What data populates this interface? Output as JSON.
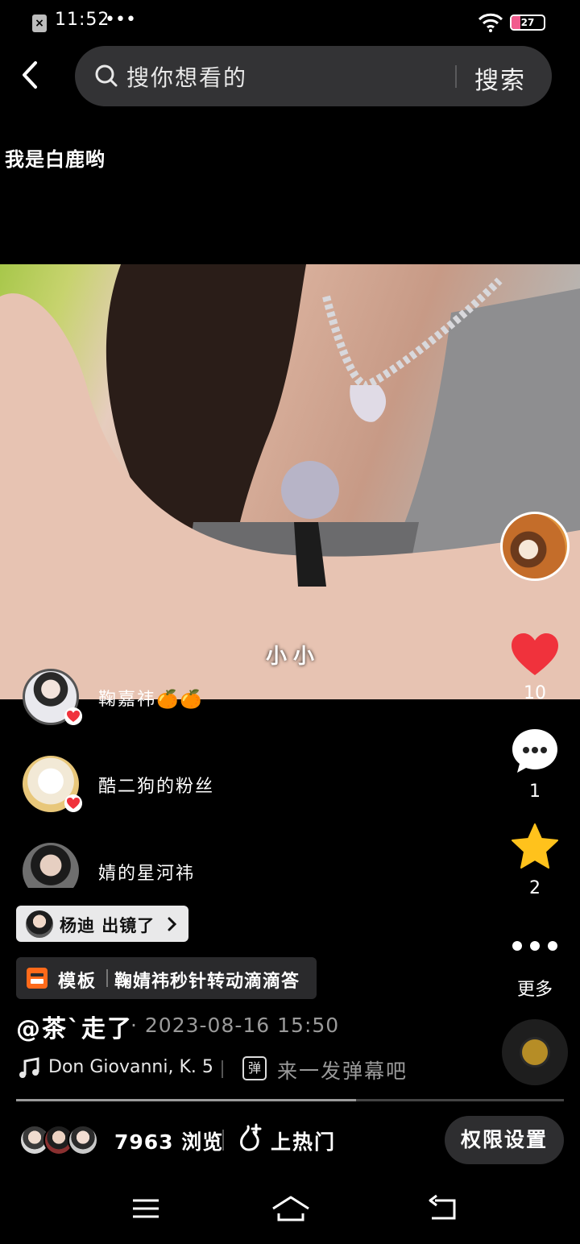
{
  "status_bar": {
    "time": "11:52",
    "dots": "•••",
    "battery_level": "27",
    "battery_fraction": 0.27
  },
  "search": {
    "placeholder": "搜你想看的",
    "button_label": "搜索"
  },
  "caption": "我是白鹿哟",
  "video": {
    "subtitle": "小小"
  },
  "actions": {
    "like_count": "10",
    "comment_count": "1",
    "favorite_count": "2",
    "more_label": "更多"
  },
  "likers": [
    {
      "name": "鞠嘉祎🍊🍊"
    },
    {
      "name": "酷二狗的粉丝"
    },
    {
      "name": "婧的星河祎"
    }
  ],
  "person_tag": {
    "text": "杨迪 出镜了"
  },
  "template_tag": {
    "label": "模板",
    "name": "鞠婧祎秒针转动滴滴答"
  },
  "post": {
    "author": "@茶`走了",
    "time": "· 2023-08-16 15:50"
  },
  "music": {
    "title": "Don Giovanni, K. 5",
    "danmu_icon": "弹",
    "danmu_prompt": "来一发弹幕吧"
  },
  "progress": {
    "fraction": 0.62
  },
  "stats": {
    "views": "7963 浏览",
    "hot_label": "上热门",
    "permission_label": "权限设置"
  },
  "colors": {
    "like": "#f0323c",
    "favorite": "#ffc21c",
    "template_icon": "#ff6a1a",
    "battery": "#f25c8e"
  },
  "icons": [
    "back-icon",
    "search-icon",
    "heart-icon",
    "comment-icon",
    "star-icon",
    "more-icon",
    "music-note-icon",
    "danmu-icon",
    "hot-icon",
    "menu-icon",
    "home-icon",
    "back-nav-icon"
  ]
}
